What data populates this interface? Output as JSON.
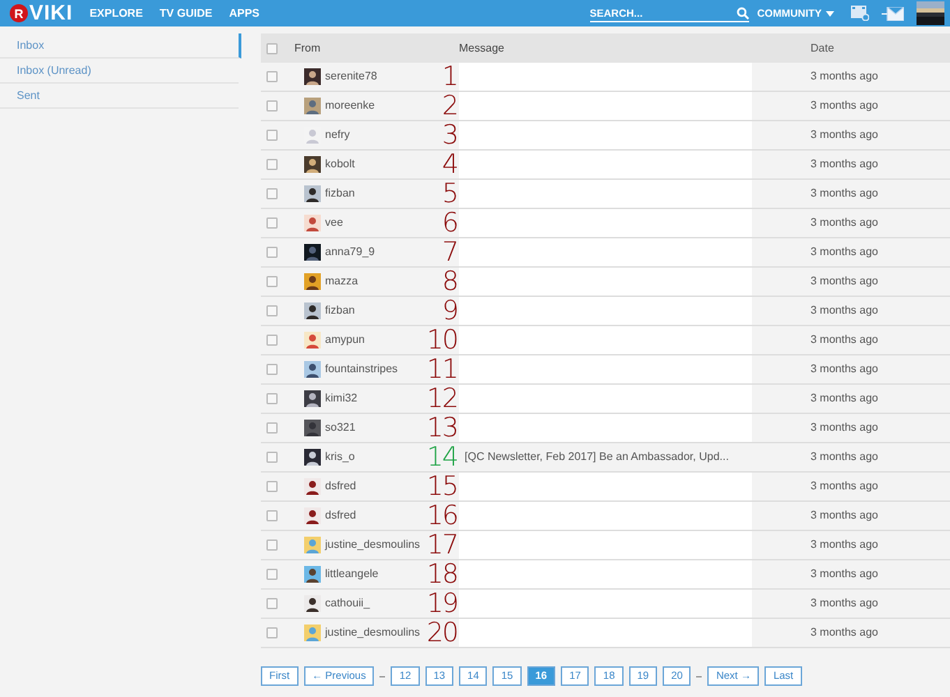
{
  "header": {
    "logo_badge": "R",
    "logo_text": "VIKI",
    "nav": [
      "EXPLORE",
      "TV GUIDE",
      "APPS"
    ],
    "search": {
      "placeholder": "SEARCH..."
    },
    "community": "COMMUNITY"
  },
  "sidebar": {
    "items": [
      {
        "label": "Inbox",
        "selected": true
      },
      {
        "label": "Inbox (Unread)",
        "selected": false
      },
      {
        "label": "Sent",
        "selected": false
      }
    ]
  },
  "table": {
    "columns": [
      "From",
      "Message",
      "Date"
    ],
    "select_all_checked": false,
    "rows": [
      {
        "checked": false,
        "from": "serenite78",
        "number": "1",
        "color": "#8b0a0a",
        "message": "",
        "redacted": true,
        "date": "3 months ago"
      },
      {
        "checked": false,
        "from": "moreenke",
        "number": "2",
        "color": "#8b0a0a",
        "message": "",
        "redacted": true,
        "date": "3 months ago"
      },
      {
        "checked": false,
        "from": "nefry",
        "number": "3",
        "color": "#8b0a0a",
        "message": "",
        "redacted": true,
        "date": "3 months ago"
      },
      {
        "checked": false,
        "from": "kobolt",
        "number": "4",
        "color": "#8b0a0a",
        "message": "",
        "redacted": true,
        "date": "3 months ago"
      },
      {
        "checked": false,
        "from": "fizban",
        "number": "5",
        "color": "#8b0a0a",
        "message": "",
        "redacted": true,
        "date": "3 months ago"
      },
      {
        "checked": false,
        "from": "vee",
        "number": "6",
        "color": "#8b0a0a",
        "message": "",
        "redacted": true,
        "date": "3 months ago"
      },
      {
        "checked": false,
        "from": "anna79_9",
        "number": "7",
        "color": "#8b0a0a",
        "message": "",
        "redacted": true,
        "date": "3 months ago"
      },
      {
        "checked": false,
        "from": "mazza",
        "number": "8",
        "color": "#8b0a0a",
        "message": "",
        "redacted": true,
        "date": "3 months ago"
      },
      {
        "checked": false,
        "from": "fizban",
        "number": "9",
        "color": "#8b0a0a",
        "message": "",
        "redacted": true,
        "date": "3 months ago"
      },
      {
        "checked": false,
        "from": "amypun",
        "number": "10",
        "color": "#8b0a0a",
        "message": "",
        "redacted": true,
        "date": "3 months ago"
      },
      {
        "checked": false,
        "from": "fountainstripes",
        "number": "11",
        "color": "#8b0a0a",
        "message": "",
        "redacted": true,
        "date": "3 months ago"
      },
      {
        "checked": false,
        "from": "kimi32",
        "number": "12",
        "color": "#8b0a0a",
        "message": "",
        "redacted": true,
        "date": "3 months ago"
      },
      {
        "checked": false,
        "from": "so321",
        "number": "13",
        "color": "#8b0a0a",
        "message": "",
        "redacted": true,
        "date": "3 months ago"
      },
      {
        "checked": false,
        "from": "kris_o",
        "number": "14",
        "color": "#1fa345",
        "message": "[QC Newsletter, Feb 2017] Be an Ambassador, Upd...",
        "redacted": false,
        "date": "3 months ago"
      },
      {
        "checked": false,
        "from": "dsfred",
        "number": "15",
        "color": "#8b0a0a",
        "message": "",
        "redacted": true,
        "date": "3 months ago"
      },
      {
        "checked": false,
        "from": "dsfred",
        "number": "16",
        "color": "#8b0a0a",
        "message": "",
        "redacted": true,
        "date": "3 months ago"
      },
      {
        "checked": false,
        "from": "justine_desmoulins",
        "number": "17",
        "color": "#8b0a0a",
        "message": "",
        "redacted": true,
        "date": "3 months ago"
      },
      {
        "checked": false,
        "from": "littleangele",
        "number": "18",
        "color": "#8b0a0a",
        "message": "",
        "redacted": true,
        "date": "3 months ago"
      },
      {
        "checked": false,
        "from": "cathouii_",
        "number": "19",
        "color": "#8b0a0a",
        "message": "",
        "redacted": true,
        "date": "3 months ago"
      },
      {
        "checked": false,
        "from": "justine_desmoulins",
        "number": "20",
        "color": "#8b0a0a",
        "message": "",
        "redacted": true,
        "date": "3 months ago"
      }
    ]
  },
  "pagination": {
    "first": "First",
    "previous": "← Previous",
    "pages": [
      {
        "label": "12",
        "selected": false
      },
      {
        "label": "13",
        "selected": false
      },
      {
        "label": "14",
        "selected": false
      },
      {
        "label": "15",
        "selected": false
      },
      {
        "label": "16",
        "selected": true
      },
      {
        "label": "17",
        "selected": false
      },
      {
        "label": "18",
        "selected": false
      },
      {
        "label": "19",
        "selected": false
      },
      {
        "label": "20",
        "selected": false
      }
    ],
    "next": "Next →",
    "last": "Last"
  }
}
